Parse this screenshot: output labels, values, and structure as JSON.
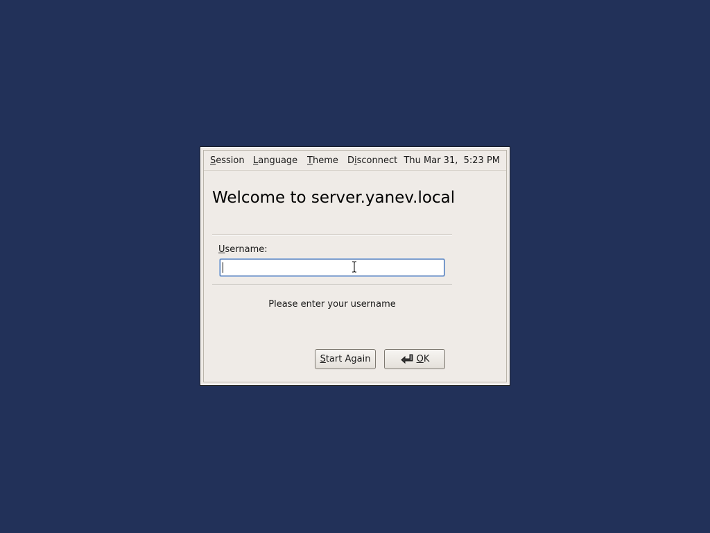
{
  "menubar": {
    "items": [
      {
        "mnemonic": "S",
        "rest": "ession"
      },
      {
        "mnemonic": "L",
        "rest": "anguage"
      },
      {
        "mnemonic": "T",
        "rest": "heme"
      },
      {
        "prefix": "D",
        "mnemonic": "i",
        "rest": "sconnect"
      }
    ],
    "clock": "Thu Mar 31,  5:23 PM"
  },
  "welcome": {
    "title": "Welcome to server.yanev.local"
  },
  "login": {
    "username_label_mnemonic": "U",
    "username_label_rest": "sername:",
    "username_value": "",
    "status_message": "Please enter your username"
  },
  "buttons": {
    "start_again_mnemonic": "S",
    "start_again_rest": "tart Again",
    "ok_mnemonic": "O",
    "ok_rest": "K"
  },
  "icons": {
    "ok_icon": "enter-icon",
    "cursor": "text-cursor-icon"
  },
  "colors": {
    "desktop_background": "#223159",
    "window_background": "#efebe7",
    "input_focus_border": "#3f6db0"
  }
}
